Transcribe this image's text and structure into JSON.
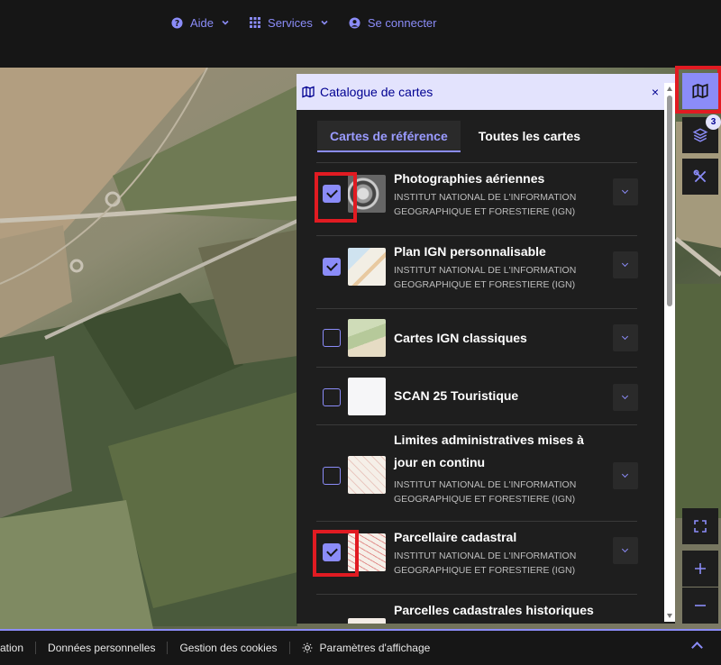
{
  "header": {
    "help_label": "Aide",
    "services_label": "Services",
    "login_label": "Se connecter"
  },
  "catalog": {
    "title": "Catalogue de cartes",
    "close_label": "×",
    "tabs": [
      {
        "label": "Cartes de référence",
        "active": true
      },
      {
        "label": "Toutes les cartes",
        "active": false
      }
    ],
    "items": [
      {
        "name": "Photographies aériennes",
        "org": "INSTITUT NATIONAL DE L'INFORMATION GEOGRAPHIQUE ET FORESTIERE (IGN)",
        "checked": true
      },
      {
        "name": "Plan IGN personnalisable",
        "org": "INSTITUT NATIONAL DE L'INFORMATION GEOGRAPHIQUE ET FORESTIERE (IGN)",
        "checked": true
      },
      {
        "name": "Cartes IGN classiques",
        "org": "",
        "checked": false
      },
      {
        "name": "SCAN 25 Touristique",
        "org": "",
        "checked": false
      },
      {
        "name": "Limites administratives mises à jour en continu",
        "org": "INSTITUT NATIONAL DE L'INFORMATION GEOGRAPHIQUE ET FORESTIERE (IGN)",
        "checked": false
      },
      {
        "name": "Parcellaire cadastral",
        "org": "INSTITUT NATIONAL DE L'INFORMATION GEOGRAPHIQUE ET FORESTIERE (IGN)",
        "checked": true
      },
      {
        "name": "Parcelles cadastrales historiques",
        "org": "",
        "checked": false
      }
    ]
  },
  "tools": {
    "layers_badge": "3"
  },
  "footer": {
    "links": [
      "ation",
      "Données personnelles",
      "Gestion des cookies",
      "Paramètres d'affichage"
    ]
  },
  "colors": {
    "accent": "#8b8cf8",
    "panel_bg": "#1e1e1e",
    "header_tint": "#e3e3fd",
    "header_text": "#000091",
    "highlight": "#e11b22"
  }
}
